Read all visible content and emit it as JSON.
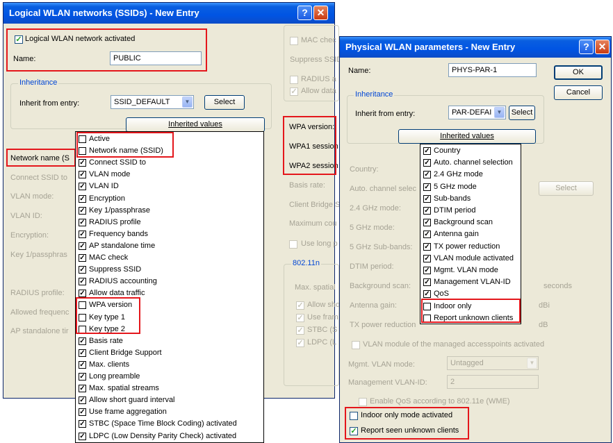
{
  "win1": {
    "title": "Logical WLAN networks (SSIDs) - New Entry",
    "logical_activated": "Logical WLAN network activated",
    "name_label": "Name:",
    "name_value": "PUBLIC",
    "inheritance_label": "Inheritance",
    "inherit_from_label": "Inherit from entry:",
    "inherit_from_value": "SSID_DEFAULT",
    "select_button": "Select",
    "inherited_values_button": "Inherited values",
    "left_labels": [
      "Network name (S",
      "Connect SSID to",
      "VLAN mode:",
      "VLAN ID:",
      "Encryption:",
      "Key 1/passphras",
      "RADIUS profile:",
      "Allowed frequenc",
      "AP standalone tir"
    ],
    "right_top": [
      "MAC chec",
      "Suppress SSID",
      "RADIUS a",
      "Allow data"
    ],
    "wpa_labels": [
      "WPA version:",
      "WPA1 session",
      "WPA2 session"
    ],
    "right_mid": [
      "Basis rate:",
      "Client Bridge S",
      "Maximum cou",
      "Use long p"
    ],
    "group_80211n": "802.11n",
    "n_items": [
      "Max. spatial",
      "Allow sho",
      "Use fram",
      "STBC (S",
      "LDPC (L"
    ]
  },
  "popup1": {
    "items": [
      {
        "label": "Active",
        "checked": false
      },
      {
        "label": "Network name (SSID)",
        "checked": false
      },
      {
        "label": "Connect SSID to",
        "checked": true
      },
      {
        "label": "VLAN mode",
        "checked": true
      },
      {
        "label": "VLAN ID",
        "checked": true
      },
      {
        "label": "Encryption",
        "checked": true
      },
      {
        "label": "Key 1/passphrase",
        "checked": true
      },
      {
        "label": "RADIUS profile",
        "checked": true
      },
      {
        "label": "Frequency bands",
        "checked": true
      },
      {
        "label": "AP standalone time",
        "checked": true
      },
      {
        "label": "MAC check",
        "checked": true
      },
      {
        "label": "Suppress SSID",
        "checked": true
      },
      {
        "label": "RADIUS accounting",
        "checked": true
      },
      {
        "label": "Allow data traffic",
        "checked": true
      },
      {
        "label": "WPA version",
        "checked": false
      },
      {
        "label": "Key type 1",
        "checked": false
      },
      {
        "label": "Key type 2",
        "checked": false
      },
      {
        "label": "Basis rate",
        "checked": true
      },
      {
        "label": "Client Bridge Support",
        "checked": true
      },
      {
        "label": "Max. clients",
        "checked": true
      },
      {
        "label": "Long preamble",
        "checked": true
      },
      {
        "label": "Max. spatial streams",
        "checked": true
      },
      {
        "label": "Allow short guard interval",
        "checked": true
      },
      {
        "label": "Use frame aggregation",
        "checked": true
      },
      {
        "label": "STBC (Space Time Block Coding) activated",
        "checked": true
      },
      {
        "label": "LDPC (Low Density Parity Check) activated",
        "checked": true
      }
    ]
  },
  "win2": {
    "title": "Physical WLAN parameters - New Entry",
    "name_label": "Name:",
    "name_value": "PHYS-PAR-1",
    "ok_button": "OK",
    "cancel_button": "Cancel",
    "inheritance_label": "Inheritance",
    "inherit_from_label": "Inherit from entry:",
    "inherit_from_value": "PAR-DEFAI",
    "select_button": "Select",
    "inherited_values_button": "Inherited values",
    "left_labels": [
      "Country:",
      "Auto. channel selec",
      "2.4 GHz mode:",
      "5 GHz mode:",
      "5 GHz Sub-bands:",
      "DTIM period:",
      "Background scan:",
      "Antenna gain:",
      "TX power reduction"
    ],
    "select2_button": "Select",
    "unit_seconds": "seconds",
    "unit_dbi": "dBi",
    "unit_db": "dB",
    "vlan_module": "VLAN module of the managed accesspoints activated",
    "mgmt_vlan_mode_label": "Mgmt. VLAN mode:",
    "mgmt_vlan_mode_value": "Untagged",
    "mgmt_vlan_id_label": "Management VLAN-ID:",
    "mgmt_vlan_id_value": "2",
    "enable_qos": "Enable QoS according to 802.11e (WME)",
    "indoor_only_mode": "Indoor only mode activated",
    "report_seen": "Report seen unknown clients"
  },
  "popup2": {
    "items": [
      {
        "label": "Country",
        "checked": true
      },
      {
        "label": "Auto. channel selection",
        "checked": true
      },
      {
        "label": "2.4 GHz mode",
        "checked": true
      },
      {
        "label": "5 GHz mode",
        "checked": true
      },
      {
        "label": "Sub-bands",
        "checked": true
      },
      {
        "label": "DTIM period",
        "checked": true
      },
      {
        "label": "Background scan",
        "checked": true
      },
      {
        "label": "Antenna gain",
        "checked": true
      },
      {
        "label": "TX power reduction",
        "checked": true
      },
      {
        "label": "VLAN module activated",
        "checked": true
      },
      {
        "label": "Mgmt. VLAN mode",
        "checked": true
      },
      {
        "label": "Management VLAN-ID",
        "checked": true
      },
      {
        "label": "QoS",
        "checked": true
      },
      {
        "label": "Indoor only",
        "checked": false
      },
      {
        "label": "Report unknown clients",
        "checked": false
      }
    ]
  },
  "colors": {
    "highlight": "#e4161b",
    "titlebar": "#0054e3",
    "group_label": "#0046d5",
    "dialog_bg": "#ece9d8"
  },
  "icons": {
    "help": "help-icon",
    "close": "close-icon",
    "dropdown": "chevron-down-icon",
    "check": "checkmark-icon"
  }
}
